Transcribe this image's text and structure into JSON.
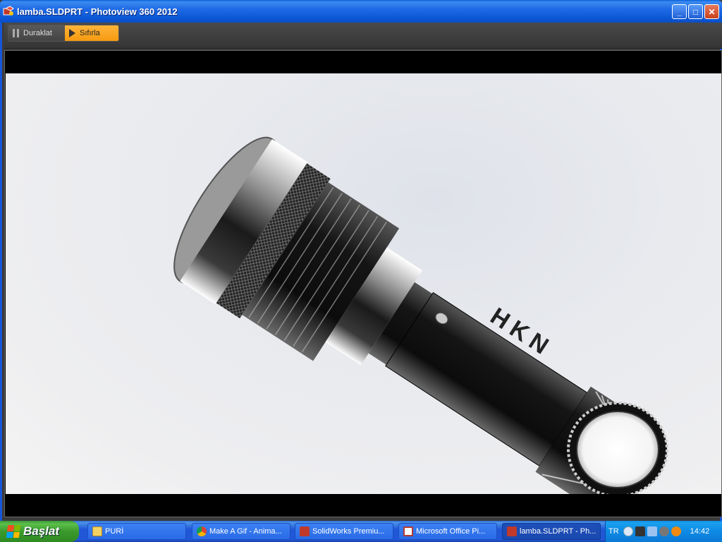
{
  "window": {
    "title": "lamba.SLDPRT - Photoview 360 2012",
    "buttons": {
      "minimize": "_",
      "maximize": "□",
      "close": "✕"
    }
  },
  "toolbar": {
    "pause_label": "Duraklat",
    "reset_label": "Sıfırla"
  },
  "render": {
    "engraving": "HKN"
  },
  "taskbar": {
    "start_label": "Başlat",
    "items": [
      {
        "label": "PURİ",
        "icon": "folder-icon"
      },
      {
        "label": "Make A Gif - Anima...",
        "icon": "chrome-icon"
      },
      {
        "label": "SolidWorks Premiu...",
        "icon": "solidworks-icon"
      },
      {
        "label": "Microsoft Office Pi...",
        "icon": "office-picture-icon"
      },
      {
        "label": "lamba.SLDPRT - Ph...",
        "icon": "photoview-icon",
        "active": true
      }
    ],
    "tray": {
      "language": "TR",
      "clock": "14:42"
    }
  },
  "colors": {
    "accent_orange": "#f59a10",
    "titlebar_blue": "#0a55d2",
    "start_green": "#3a9a2c"
  }
}
